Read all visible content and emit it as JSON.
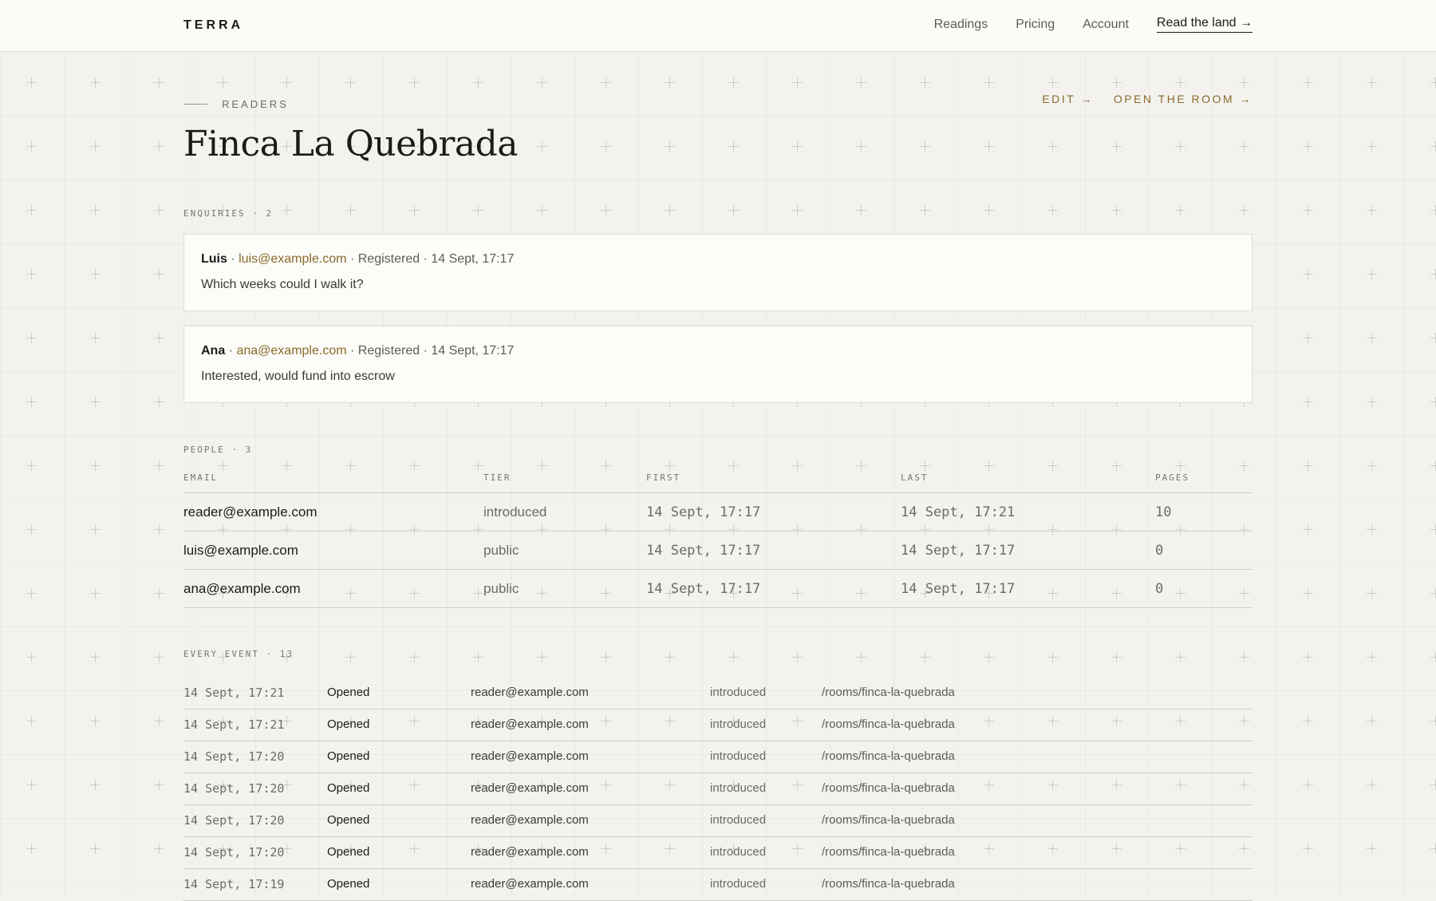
{
  "header": {
    "brand": "TERRA",
    "nav": [
      "Readings",
      "Pricing",
      "Account"
    ],
    "cta": "Read the land →"
  },
  "page": {
    "eyebrow": "READERS",
    "title": "Finca La Quebrada",
    "actions": {
      "edit": "EDIT →",
      "open": "OPEN THE ROOM →"
    }
  },
  "enquiries": {
    "label": "ENQUIRIES · 2",
    "items": [
      {
        "name": "Luis",
        "email": "luis@example.com",
        "meta": " · Registered · 14 Sept, 17:17",
        "message": "Which weeks could I walk it?"
      },
      {
        "name": "Ana",
        "email": "ana@example.com",
        "meta": " · Registered · 14 Sept, 17:17",
        "message": "Interested, would fund into escrow"
      }
    ]
  },
  "people": {
    "label": "PEOPLE · 3",
    "columns": [
      "EMAIL",
      "TIER",
      "FIRST",
      "LAST",
      "PAGES"
    ],
    "rows": [
      [
        "reader@example.com",
        "introduced",
        "14 Sept, 17:17",
        "14 Sept, 17:21",
        "10"
      ],
      [
        "luis@example.com",
        "public",
        "14 Sept, 17:17",
        "14 Sept, 17:17",
        "0"
      ],
      [
        "ana@example.com",
        "public",
        "14 Sept, 17:17",
        "14 Sept, 17:17",
        "0"
      ]
    ]
  },
  "events": {
    "label": "EVERY EVENT · 13",
    "rows": [
      [
        "14 Sept, 17:21",
        "Opened",
        "reader@example.com",
        "introduced",
        "/rooms/finca-la-quebrada"
      ],
      [
        "14 Sept, 17:21",
        "Opened",
        "reader@example.com",
        "introduced",
        "/rooms/finca-la-quebrada"
      ],
      [
        "14 Sept, 17:20",
        "Opened",
        "reader@example.com",
        "introduced",
        "/rooms/finca-la-quebrada"
      ],
      [
        "14 Sept, 17:20",
        "Opened",
        "reader@example.com",
        "introduced",
        "/rooms/finca-la-quebrada"
      ],
      [
        "14 Sept, 17:20",
        "Opened",
        "reader@example.com",
        "introduced",
        "/rooms/finca-la-quebrada"
      ],
      [
        "14 Sept, 17:20",
        "Opened",
        "reader@example.com",
        "introduced",
        "/rooms/finca-la-quebrada"
      ],
      [
        "14 Sept, 17:19",
        "Opened",
        "reader@example.com",
        "introduced",
        "/rooms/finca-la-quebrada"
      ]
    ]
  },
  "colors": {
    "accent": "#8a6a2c",
    "background": "#f3f2ee",
    "card": "#fcfcf9"
  }
}
